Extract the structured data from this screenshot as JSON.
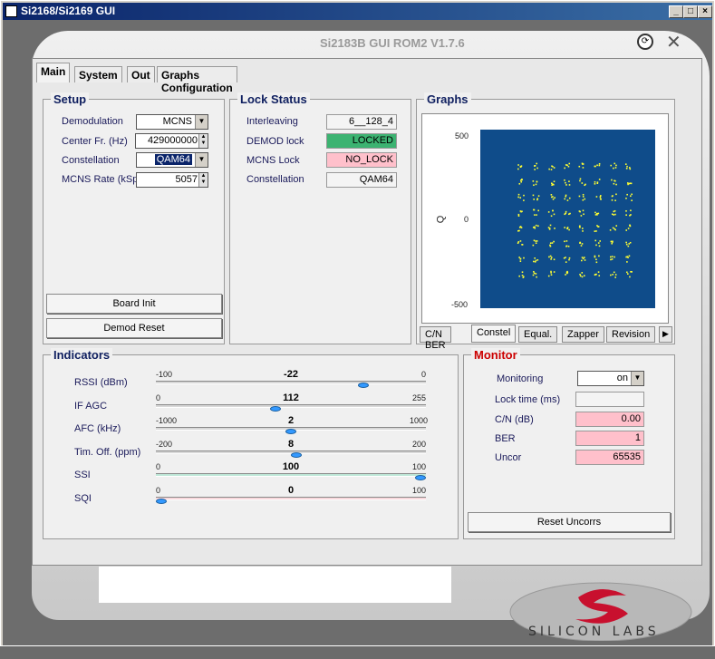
{
  "window": {
    "title": "Si2168/Si2169 GUI",
    "app_title": "Si2183B GUI ROM2 V1.7.6"
  },
  "tabs": [
    "Main",
    "System",
    "Out",
    "Graphs Configuration"
  ],
  "setup": {
    "title": "Setup",
    "demodulation_label": "Demodulation",
    "demodulation_value": "MCNS",
    "center_label": "Center Fr. (Hz)",
    "center_value": "429000000",
    "constellation_label": "Constellation",
    "constellation_value": "QAM64",
    "rate_label": "MCNS Rate (kSps",
    "rate_value": "5057",
    "board_init": "Board Init",
    "demod_reset": "Demod Reset"
  },
  "lock": {
    "title": "Lock Status",
    "interleaving_label": "Interleaving",
    "interleaving_value": "6__128_4",
    "demod_label": "DEMOD lock",
    "demod_value": "LOCKED",
    "mcns_label": "MCNS Lock",
    "mcns_value": "NO_LOCK",
    "constellation_label": "Constellation",
    "constellation_value": "QAM64",
    "locked_color": "#3cb371",
    "nolock_color": "#ffc0cb"
  },
  "graphs": {
    "title": "Graphs",
    "y_max": "500",
    "y_mid": "0",
    "y_min": "-500",
    "axis_q": "Q",
    "tabs": [
      "C/N BER",
      "Constel",
      "Equal.",
      "Zapper",
      "Revision"
    ],
    "plot_bg": "#0f4c8a",
    "point_color": "#ffff33"
  },
  "indicators": {
    "title": "Indicators",
    "rows": [
      {
        "label": "RSSI (dBm)",
        "min": "-100",
        "max": "0",
        "value": "-22",
        "fraction": 0.78
      },
      {
        "label": "IF AGC",
        "min": "0",
        "max": "255",
        "value": "112",
        "fraction": 0.44
      },
      {
        "label": "AFC (kHz)",
        "min": "-1000",
        "max": "1000",
        "value": "2",
        "fraction": 0.5
      },
      {
        "label": "Tim. Off. (ppm)",
        "min": "-200",
        "max": "200",
        "value": "8",
        "fraction": 0.52
      },
      {
        "label": "SSI",
        "min": "0",
        "max": "100",
        "value": "100",
        "fraction": 1.0
      },
      {
        "label": "SQI",
        "min": "0",
        "max": "100",
        "value": "0",
        "fraction": 0.0
      }
    ]
  },
  "monitor": {
    "title": "Monitor",
    "monitoring_label": "Monitoring",
    "monitoring_value": "on",
    "locktime_label": "Lock time (ms)",
    "locktime_value": "",
    "cn_label": "C/N (dB)",
    "cn_value": "0.00",
    "ber_label": "BER",
    "ber_value": "1",
    "uncor_label": "Uncor",
    "uncor_value": "65535",
    "reset_uncors": "Reset Uncorrs"
  },
  "logo": {
    "text": "SILICON LABS",
    "color": "#c8102e"
  }
}
